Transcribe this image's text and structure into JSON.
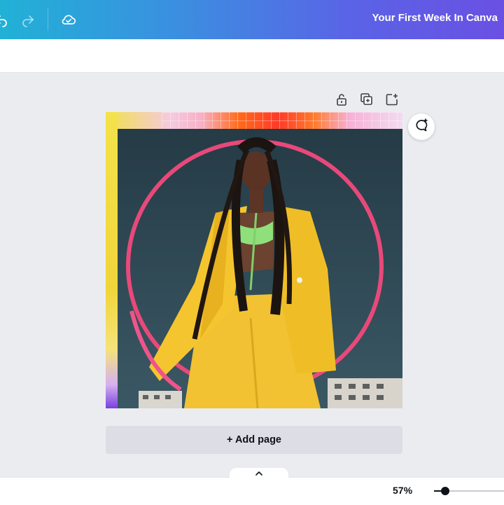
{
  "header": {
    "doc_title": "Your First Week In Canva",
    "undo_icon": "undo-icon",
    "redo_icon": "redo-icon",
    "save_status_icon": "cloud-check-icon",
    "gradient_start": "#21b1d6",
    "gradient_end": "#6a50e3"
  },
  "page_tools": [
    {
      "icon": "unlock-icon"
    },
    {
      "icon": "duplicate-page-icon"
    },
    {
      "icon": "add-page-icon"
    }
  ],
  "side": {
    "comment_icon": "add-comment-icon"
  },
  "canvas": {
    "add_page_label": "+ Add page"
  },
  "footer": {
    "collapse_icon": "chevron-up-icon",
    "zoom_label": "57%",
    "zoom_fraction": 0.16
  }
}
